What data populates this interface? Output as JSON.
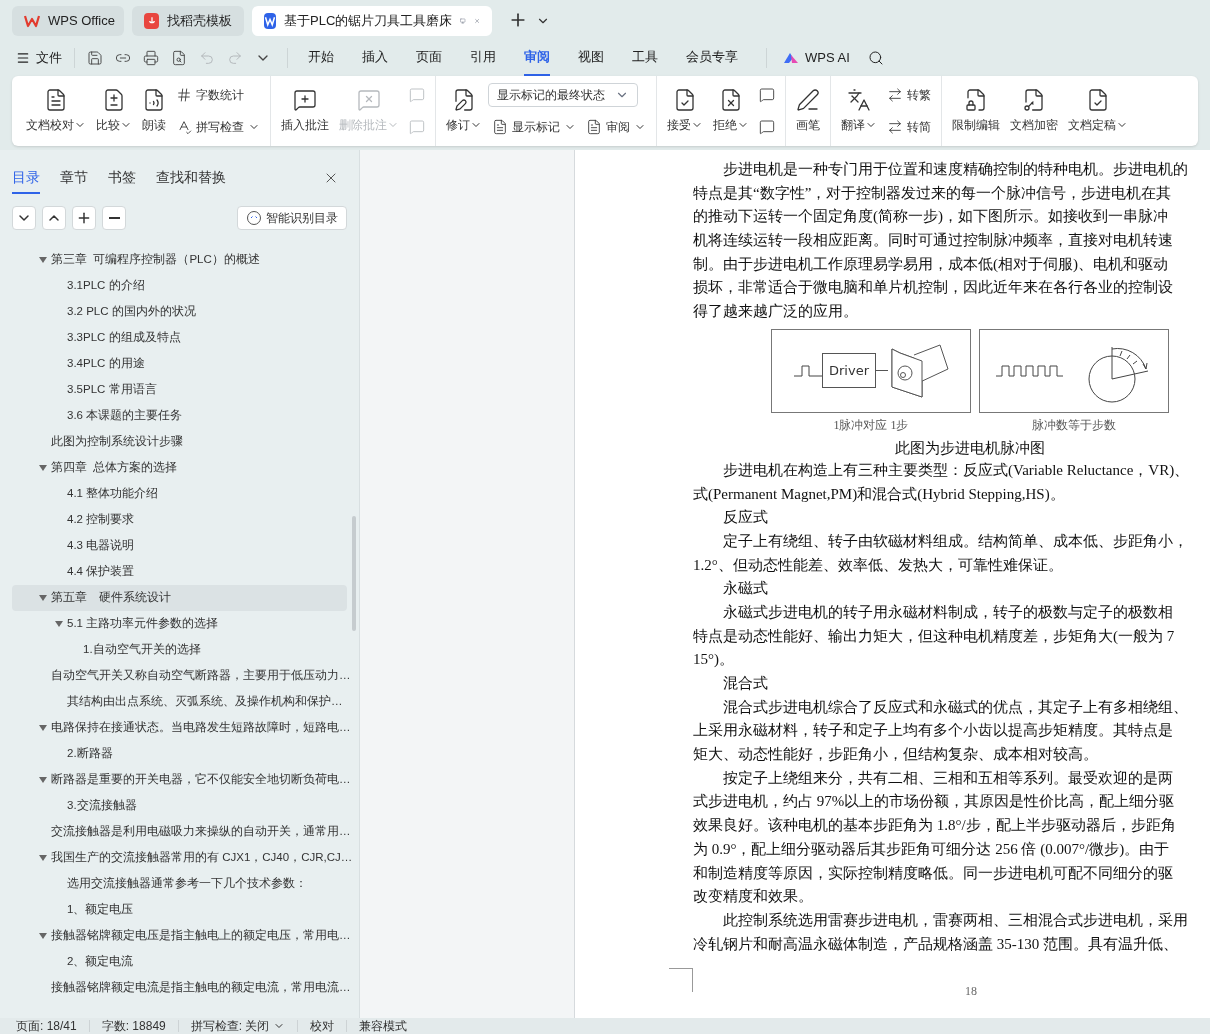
{
  "tabs": [
    {
      "kind": "home",
      "label": "WPS Office",
      "selected": false
    },
    {
      "kind": "template",
      "label": "找稻壳模板",
      "selected": false
    },
    {
      "kind": "doc",
      "label": "基于PLC的锯片刀具工具磨床",
      "selected": true
    }
  ],
  "menu": {
    "file": "文件",
    "tabs": [
      {
        "label": "开始",
        "selected": false
      },
      {
        "label": "插入",
        "selected": false
      },
      {
        "label": "页面",
        "selected": false
      },
      {
        "label": "引用",
        "selected": false
      },
      {
        "label": "审阅",
        "selected": true
      },
      {
        "label": "视图",
        "selected": false
      },
      {
        "label": "工具",
        "selected": false
      },
      {
        "label": "会员专享",
        "selected": false
      }
    ],
    "ai": "WPS AI"
  },
  "ribbon": [
    {
      "items": [
        {
          "kind": "large",
          "label": "文档校对",
          "caret": true,
          "disabled": false
        },
        {
          "kind": "large",
          "label": "比较",
          "caret": true,
          "disabled": false
        },
        {
          "kind": "large",
          "label": "朗读",
          "caret": false,
          "disabled": false
        },
        {
          "kind": "stack",
          "rows": [
            [
              {
                "kind": "small",
                "label": "字数统计",
                "caret": false,
                "disabled": false
              }
            ],
            [
              {
                "kind": "small",
                "label": "拼写检查",
                "caret": true,
                "disabled": false
              }
            ]
          ]
        }
      ]
    },
    {
      "items": [
        {
          "kind": "large",
          "label": "插入批注",
          "caret": false,
          "disabled": false
        },
        {
          "kind": "large",
          "label": "删除批注",
          "caret": true,
          "disabled": true
        },
        {
          "kind": "stack",
          "rows": [
            [
              {
                "kind": "icon",
                "disabled": true
              }
            ],
            [
              {
                "kind": "icon",
                "disabled": true
              }
            ]
          ]
        }
      ]
    },
    {
      "items": [
        {
          "kind": "large",
          "label": "修订",
          "caret": true,
          "disabled": false
        },
        {
          "kind": "stack",
          "rows": [
            [
              {
                "kind": "select",
                "value": "显示标记的最终状态"
              }
            ],
            [
              {
                "kind": "small",
                "label": "显示标记",
                "caret": true,
                "disabled": false
              },
              {
                "kind": "small",
                "label": "审阅",
                "caret": true,
                "disabled": false
              }
            ]
          ]
        }
      ]
    },
    {
      "items": [
        {
          "kind": "large",
          "label": "接受",
          "caret": true,
          "disabled": false
        },
        {
          "kind": "large",
          "label": "拒绝",
          "caret": true,
          "disabled": false
        },
        {
          "kind": "stack",
          "rows": [
            [
              {
                "kind": "icon",
                "disabled": false
              }
            ],
            [
              {
                "kind": "icon",
                "disabled": false
              }
            ]
          ]
        }
      ]
    },
    {
      "items": [
        {
          "kind": "large",
          "label": "画笔",
          "caret": false,
          "disabled": false
        }
      ]
    },
    {
      "items": [
        {
          "kind": "large",
          "label": "翻译",
          "caret": true,
          "disabled": false
        },
        {
          "kind": "stack",
          "rows": [
            [
              {
                "kind": "small",
                "label": "转繁",
                "caret": false,
                "disabled": false
              }
            ],
            [
              {
                "kind": "small",
                "label": "转简",
                "caret": false,
                "disabled": false
              }
            ]
          ]
        }
      ]
    },
    {
      "items": [
        {
          "kind": "large",
          "label": "限制编辑",
          "caret": false,
          "disabled": false
        },
        {
          "kind": "large",
          "label": "文档加密",
          "caret": false,
          "disabled": false
        },
        {
          "kind": "large",
          "label": "文档定稿",
          "caret": true,
          "disabled": false
        }
      ]
    }
  ],
  "sidebar": {
    "tabs": [
      {
        "label": "目录",
        "selected": true
      },
      {
        "label": "章节",
        "selected": false
      },
      {
        "label": "书签",
        "selected": false
      },
      {
        "label": "查找和替换",
        "selected": false
      }
    ],
    "smart_button": "智能识别目录",
    "items": [
      {
        "label": "第三章  可编程序控制器（PLC）的概述",
        "expanded": true,
        "selected": false,
        "children": [
          {
            "label": "3.1PLC 的介绍",
            "selected": false
          },
          {
            "label": "3.2 PLC 的国内外的状况",
            "selected": false
          },
          {
            "label": "3.3PLC 的组成及特点",
            "selected": false
          },
          {
            "label": "3.4PLC 的用途",
            "selected": false
          },
          {
            "label": "3.5PLC 常用语言",
            "selected": false
          },
          {
            "label": "3.6 本课题的主要任务",
            "selected": false
          }
        ]
      },
      {
        "label": "此图为控制系统设计步骤",
        "selected": false
      },
      {
        "label": "第四章  总体方案的选择",
        "expanded": true,
        "selected": false,
        "children": [
          {
            "label": "4.1 整体功能介绍",
            "selected": false
          },
          {
            "label": "4.2 控制要求",
            "selected": false
          },
          {
            "label": "4.3 电器说明",
            "selected": false
          },
          {
            "label": "4.4 保护装置",
            "selected": false
          }
        ]
      },
      {
        "label": "第五章　硬件系统设计",
        "expanded": true,
        "selected": true,
        "children": [
          {
            "label": "5.1 主路功率元件参数的选择",
            "expanded": true,
            "selected": false,
            "children": [
              {
                "label": "1.自动空气开关的选择",
                "selected": false
              }
            ]
          }
        ]
      },
      {
        "label": "自动空气开关又称自动空气断路器，主要用于低压动力…",
        "selected": false,
        "children": [
          {
            "label": "其结构由出点系统、灭弧系统、及操作机构和保护…",
            "selected": false
          }
        ]
      },
      {
        "label": "电路保持在接通状态。当电路发生短路故障时，短路电…",
        "expanded": true,
        "selected": false,
        "children": [
          {
            "label": "2.断路器",
            "selected": false
          }
        ]
      },
      {
        "label": "断路器是重要的开关电器，它不仅能安全地切断负荷电…",
        "expanded": true,
        "selected": false,
        "children": [
          {
            "label": "3.交流接触器",
            "selected": false
          }
        ]
      },
      {
        "label": "交流接触器是利用电磁吸力来操纵的自动开关，通常用…",
        "selected": false
      },
      {
        "label": "我国生产的交流接触器常用的有 CJX1，CJ40，CJR,CJ…",
        "expanded": true,
        "selected": false,
        "children": [
          {
            "label": "选用交流接触器通常参考一下几个技术参数：",
            "selected": false
          },
          {
            "label": "1、额定电压",
            "selected": false
          }
        ]
      },
      {
        "label": "接触器铭牌额定电压是指主触电上的额定电压，常用电…",
        "expanded": true,
        "selected": false,
        "children": [
          {
            "label": "2、额定电流",
            "selected": false
          }
        ]
      },
      {
        "label": "接触器铭牌额定电流是指主触电的额定电流，常用电流…",
        "selected": false
      }
    ]
  },
  "document": {
    "blocks": [
      {
        "kind": "para",
        "lines": [
          "步进电机是一种专门用于位置和速度精确控制的特种电机。步进电机的",
          "特点是其“数字性”，对于控制器发过来的每一个脉冲信号，步进电机在其",
          "的推动下运转一个固定角度(简称一步)，如下图所示。如接收到一串脉冲",
          "机将连续运转一段相应距离。同时可通过控制脉冲频率，直接对电机转速",
          "制。由于步进电机工作原理易学易用，成本低(相对于伺服)、电机和驱动",
          "损坏，非常适合于微电脑和单片机控制，因此近年来在各行各业的控制设",
          "得了越来越广泛的应用。"
        ]
      },
      {
        "kind": "figure",
        "driver": "Driver",
        "captions": [
          "1脉冲对应 1步",
          "脉冲数等于步数"
        ],
        "title": "此图为步进电机脉冲图"
      },
      {
        "kind": "para",
        "lines": [
          "步进电机在构造上有三种主要类型：反应式(Variable Reluctance，VR)、",
          "式(Permanent Magnet,PM)和混合式(Hybrid Stepping,HS)。"
        ]
      },
      {
        "kind": "para",
        "lines": [
          "反应式"
        ]
      },
      {
        "kind": "para",
        "lines": [
          "定子上有绕组、转子由软磁材料组成。结构简单、成本低、步距角小，",
          "1.2°、但动态性能差、效率低、发热大，可靠性难保证。"
        ]
      },
      {
        "kind": "para",
        "lines": [
          "永磁式"
        ]
      },
      {
        "kind": "para",
        "lines": [
          "永磁式步进电机的转子用永磁材料制成，转子的极数与定子的极数相",
          "特点是动态性能好、输出力矩大，但这种电机精度差，步矩角大(一般为 7",
          "15°)。"
        ]
      },
      {
        "kind": "para",
        "lines": [
          "混合式"
        ]
      },
      {
        "kind": "para",
        "lines": [
          "混合式步进电机综合了反应式和永磁式的优点，其定子上有多相绕组、",
          "上采用永磁材料，转子和定子上均有多个小齿以提高步矩精度。其特点是",
          "矩大、动态性能好，步距角小，但结构复杂、成本相对较高。"
        ]
      },
      {
        "kind": "para",
        "lines": [
          "按定子上绕组来分，共有二相、三相和五相等系列。最受欢迎的是两",
          "式步进电机，约占 97%以上的市场份额，其原因是性价比高，配上细分驱",
          "效果良好。该种电机的基本步距角为 1.8°/步，配上半步驱动器后，步距角",
          "为 0.9°，配上细分驱动器后其步距角可细分达 256 倍 (0.007°/微步)。由于",
          "和制造精度等原因，实际控制精度略低。同一步进电机可配不同细分的驱",
          "改变精度和效果。"
        ]
      },
      {
        "kind": "para",
        "lines": [
          "此控制系统选用雷赛步进电机，雷赛两相、三相混合式步进电机，采用",
          "冷轧钢片和耐高温永磁体制造，产品规格涵盖 35-130 范围。具有温升低、"
        ]
      }
    ],
    "page_number": "18"
  },
  "status_bar": {
    "page": "页面: 18/41",
    "words": "字数: 18849",
    "spell": "拼写检查: 关闭",
    "proof": "校对",
    "mode": "兼容模式"
  }
}
